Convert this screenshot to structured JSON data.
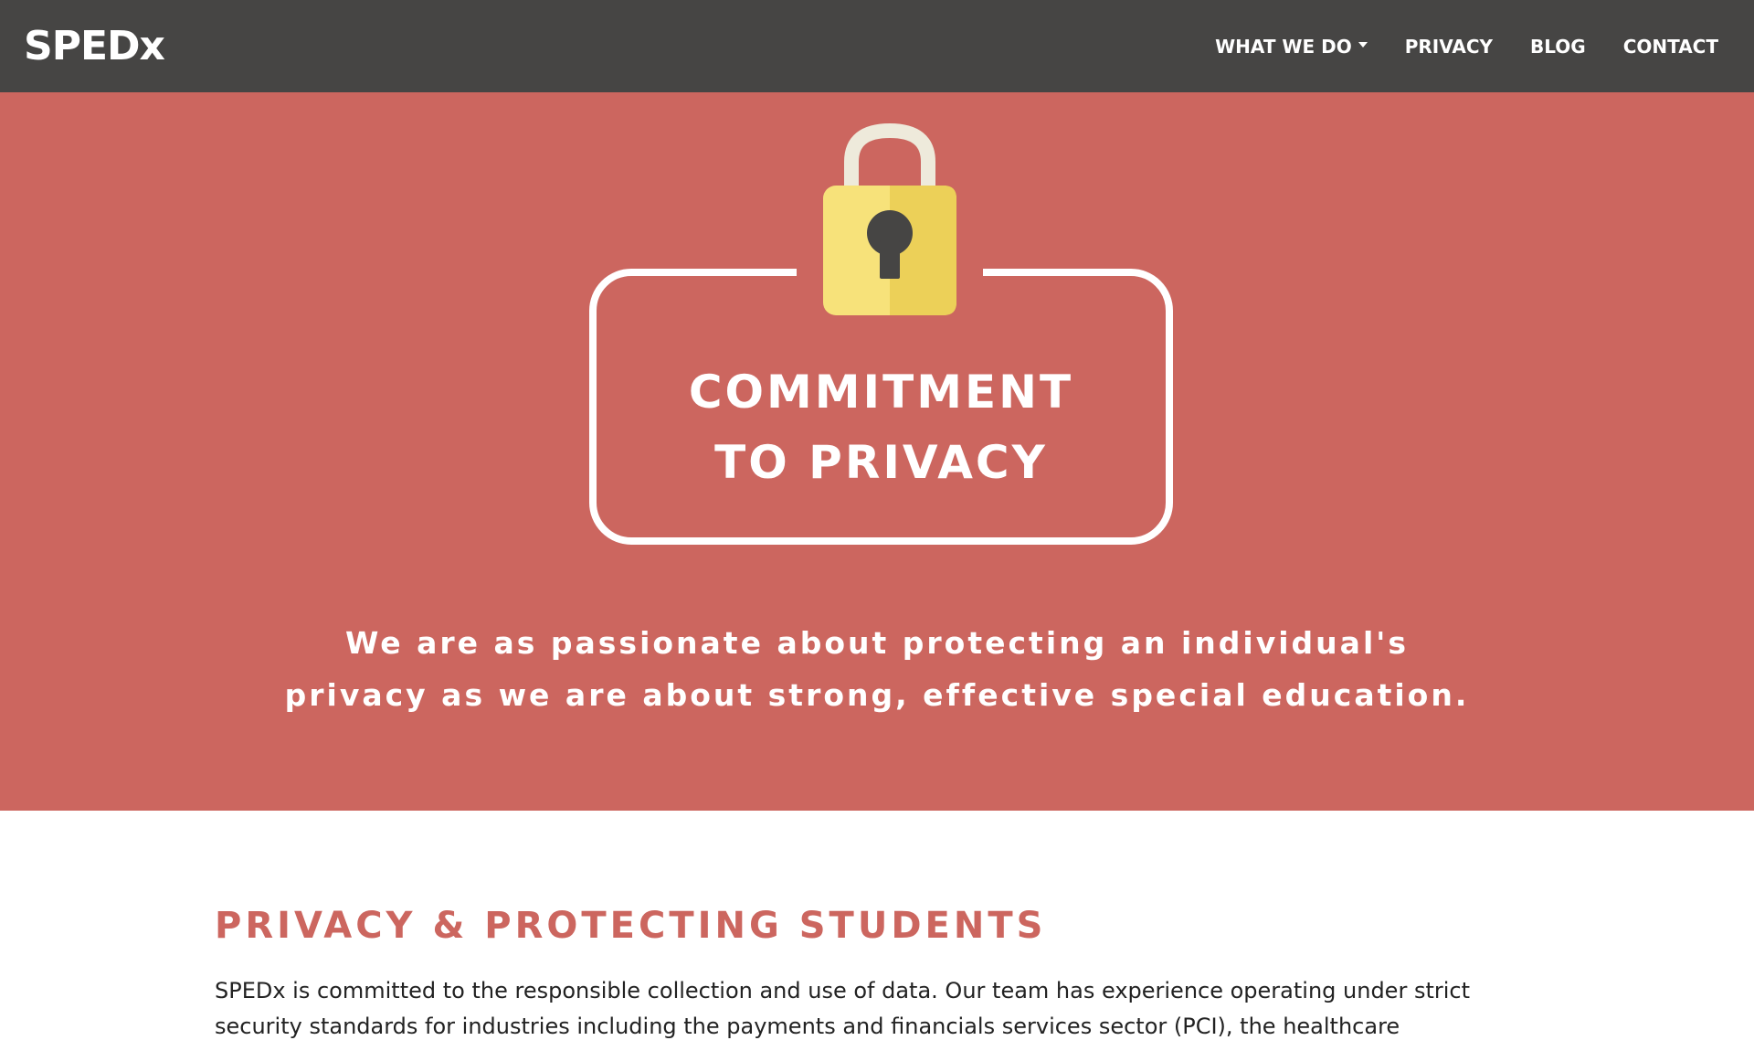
{
  "navbar": {
    "logo": "SPEDx",
    "links": [
      {
        "label": "WHAT WE DO",
        "has_dropdown": true
      },
      {
        "label": "PRIVACY"
      },
      {
        "label": "BLOG"
      },
      {
        "label": "CONTACT"
      }
    ]
  },
  "hero": {
    "title_line1": "COMMITMENT",
    "title_line2": "TO PRIVACY",
    "subtitle_line1": "We are as passionate about protecting an individual's",
    "subtitle_line2": "privacy as we are about strong, effective special education.",
    "icon": "padlock-icon"
  },
  "section": {
    "title": "PRIVACY & PROTECTING STUDENTS",
    "body_line1": "SPEDx is committed to the responsible collection and use of data. Our team has experience operating under strict",
    "body_line2": "security standards for industries including the payments and financials services sector (PCI), the healthcare"
  },
  "colors": {
    "navbar_bg": "#464544",
    "hero_bg": "#cc665f",
    "accent": "#cc665f",
    "lock_body": "#f7e27a",
    "lock_shackle": "#eeeadb",
    "keyhole": "#464544"
  }
}
